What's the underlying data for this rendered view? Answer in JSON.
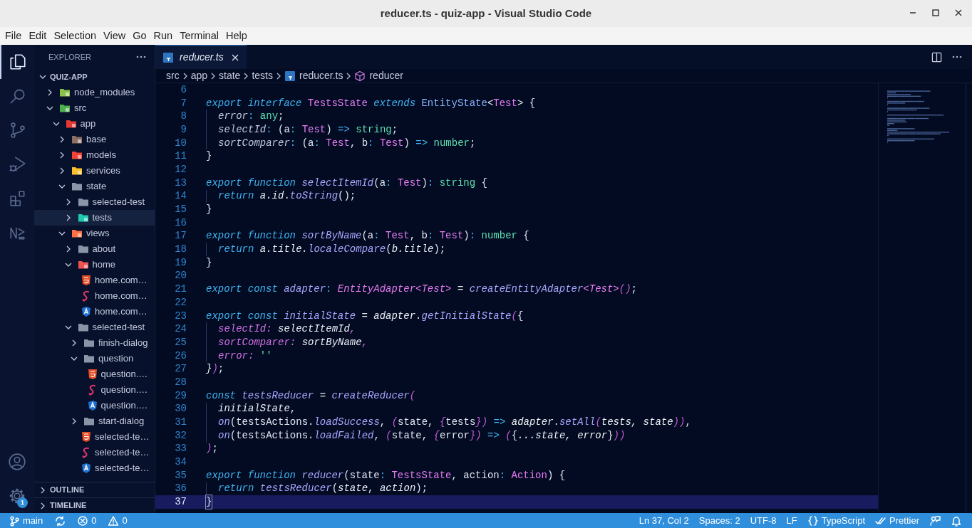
{
  "window": {
    "title": "reducer.ts - quiz-app - Visual Studio Code"
  },
  "menu": [
    "File",
    "Edit",
    "Selection",
    "View",
    "Go",
    "Run",
    "Terminal",
    "Help"
  ],
  "activity_bar": [
    {
      "kind": "files",
      "selected": true
    },
    {
      "kind": "search",
      "selected": false
    },
    {
      "kind": "source-control",
      "selected": false
    },
    {
      "kind": "run-debug",
      "selected": false
    },
    {
      "kind": "extensions",
      "selected": false
    },
    {
      "kind": "logo",
      "selected": false
    }
  ],
  "activity_bar_bottom": [
    {
      "kind": "account"
    },
    {
      "kind": "settings",
      "badge": "1"
    }
  ],
  "sidebar": {
    "title": "EXPLORER",
    "root": {
      "label": "QUIZ-APP",
      "expanded": true,
      "children": [
        {
          "label": "node_modules",
          "kind": "node",
          "expanded": false,
          "selected": false
        },
        {
          "label": "src",
          "kind": "src",
          "expanded": true,
          "selected": false,
          "children": [
            {
              "label": "app",
              "kind": "app",
              "expanded": true,
              "selected": false,
              "children": [
                {
                  "label": "base",
                  "kind": "base",
                  "expanded": false,
                  "selected": false
                },
                {
                  "label": "models",
                  "kind": "models",
                  "expanded": false,
                  "selected": false
                },
                {
                  "label": "services",
                  "kind": "services",
                  "expanded": false,
                  "selected": false
                },
                {
                  "label": "state",
                  "kind": "folder",
                  "expanded": true,
                  "selected": false,
                  "children": [
                    {
                      "label": "selected-test",
                      "kind": "folder",
                      "expanded": false,
                      "selected": false
                    },
                    {
                      "label": "tests",
                      "kind": "tests",
                      "expanded": false,
                      "selected": true
                    }
                  ]
                },
                {
                  "label": "views",
                  "kind": "views",
                  "expanded": true,
                  "selected": false,
                  "children": [
                    {
                      "label": "about",
                      "kind": "folder",
                      "expanded": false,
                      "selected": false
                    },
                    {
                      "label": "home",
                      "kind": "home",
                      "expanded": true,
                      "selected": false,
                      "children": [
                        {
                          "label": "home.com…",
                          "kind": "html",
                          "selected": false
                        },
                        {
                          "label": "home.com…",
                          "kind": "scss",
                          "selected": false
                        },
                        {
                          "label": "home.com…",
                          "kind": "angular",
                          "selected": false
                        }
                      ]
                    },
                    {
                      "label": "selected-test",
                      "kind": "folder",
                      "expanded": true,
                      "selected": false,
                      "children": [
                        {
                          "label": "finish-dialog",
                          "kind": "folder",
                          "expanded": false,
                          "selected": false
                        },
                        {
                          "label": "question",
                          "kind": "folder",
                          "expanded": true,
                          "selected": false,
                          "children": [
                            {
                              "label": "question.…",
                              "kind": "html",
                              "selected": false
                            },
                            {
                              "label": "question.…",
                              "kind": "scss",
                              "selected": false
                            },
                            {
                              "label": "question.…",
                              "kind": "angular",
                              "selected": false
                            }
                          ]
                        },
                        {
                          "label": "start-dialog",
                          "kind": "folder",
                          "expanded": false,
                          "selected": false
                        },
                        {
                          "label": "selected-te…",
                          "kind": "html",
                          "selected": false
                        },
                        {
                          "label": "selected-te…",
                          "kind": "scss",
                          "selected": false
                        },
                        {
                          "label": "selected-te…",
                          "kind": "angular",
                          "selected": false
                        }
                      ]
                    }
                  ]
                }
              ]
            }
          ]
        }
      ]
    },
    "sections": [
      {
        "label": "OUTLINE",
        "expanded": false
      },
      {
        "label": "TIMELINE",
        "expanded": false
      }
    ]
  },
  "tabs": [
    {
      "label": "reducer.ts",
      "kind": "ts",
      "selected": true
    }
  ],
  "breadcrumbs": [
    {
      "label": "src",
      "kind": "folder"
    },
    {
      "label": "app",
      "kind": "folder"
    },
    {
      "label": "state",
      "kind": "folder"
    },
    {
      "label": "tests",
      "kind": "folder"
    },
    {
      "label": "reducer.ts",
      "kind": "ts"
    },
    {
      "label": "reducer",
      "kind": "symbol"
    }
  ],
  "editor": {
    "lines": [
      {
        "number": "6",
        "current": false
      },
      {
        "number": "7",
        "current": false,
        "tokens": [
          {
            "text": "export ",
            "kind": "kw"
          },
          {
            "text": "interface ",
            "kind": "kw"
          },
          {
            "text": "TestsState ",
            "kind": "type"
          },
          {
            "text": "extends ",
            "kind": "kw"
          },
          {
            "text": "EntityState",
            "kind": "etype"
          },
          {
            "text": "<",
            "kind": "plain"
          },
          {
            "text": "Test",
            "kind": "type"
          },
          {
            "text": "> {",
            "kind": "plain"
          }
        ]
      },
      {
        "number": "8",
        "current": false,
        "indented": true,
        "tokens": [
          {
            "text": "error",
            "kind": "prop"
          },
          {
            "text": ": ",
            "kind": "op"
          },
          {
            "text": "any",
            "kind": "prim"
          },
          {
            "text": ";",
            "kind": "plain"
          }
        ]
      },
      {
        "number": "9",
        "current": false,
        "indented": true,
        "tokens": [
          {
            "text": "selectId",
            "kind": "prop"
          },
          {
            "text": ": ",
            "kind": "op"
          },
          {
            "text": "(a",
            "kind": "plain"
          },
          {
            "text": ": ",
            "kind": "op"
          },
          {
            "text": "Test",
            "kind": "type"
          },
          {
            "text": ") ",
            "kind": "plain"
          },
          {
            "text": "=> ",
            "kind": "op"
          },
          {
            "text": "string",
            "kind": "prim"
          },
          {
            "text": ";",
            "kind": "plain"
          }
        ]
      },
      {
        "number": "10",
        "current": false,
        "indented": true,
        "tokens": [
          {
            "text": "sortComparer",
            "kind": "prop"
          },
          {
            "text": ": ",
            "kind": "op"
          },
          {
            "text": "(a",
            "kind": "plain"
          },
          {
            "text": ": ",
            "kind": "op"
          },
          {
            "text": "Test",
            "kind": "type"
          },
          {
            "text": ", b",
            "kind": "plain"
          },
          {
            "text": ": ",
            "kind": "op"
          },
          {
            "text": "Test",
            "kind": "type"
          },
          {
            "text": ") ",
            "kind": "plain"
          },
          {
            "text": "=> ",
            "kind": "op"
          },
          {
            "text": "number",
            "kind": "prim"
          },
          {
            "text": ";",
            "kind": "plain"
          }
        ]
      },
      {
        "number": "11",
        "current": false,
        "tokens": [
          {
            "text": "}",
            "kind": "plain"
          }
        ]
      },
      {
        "number": "12",
        "current": false
      },
      {
        "number": "13",
        "current": false,
        "tokens": [
          {
            "text": "export function ",
            "kind": "kw"
          },
          {
            "text": "selectItemId",
            "kind": "fn"
          },
          {
            "text": "(a",
            "kind": "plain"
          },
          {
            "text": ": ",
            "kind": "op"
          },
          {
            "text": "Test",
            "kind": "type"
          },
          {
            "text": ")",
            "kind": "plain"
          },
          {
            "text": ": ",
            "kind": "op"
          },
          {
            "text": "string",
            "kind": "prim"
          },
          {
            "text": " {",
            "kind": "plain"
          }
        ]
      },
      {
        "number": "14",
        "current": false,
        "indented": true,
        "tokens": [
          {
            "text": "return ",
            "kind": "kw"
          },
          {
            "text": "a.id",
            "kind": "var"
          },
          {
            "text": ".",
            "kind": "plain"
          },
          {
            "text": "toString",
            "kind": "fn"
          },
          {
            "text": "();",
            "kind": "plain"
          }
        ]
      },
      {
        "number": "15",
        "current": false,
        "tokens": [
          {
            "text": "}",
            "kind": "plain"
          }
        ]
      },
      {
        "number": "16",
        "current": false
      },
      {
        "number": "17",
        "current": false,
        "tokens": [
          {
            "text": "export function ",
            "kind": "kw"
          },
          {
            "text": "sortByName",
            "kind": "fn"
          },
          {
            "text": "(a",
            "kind": "plain"
          },
          {
            "text": ": ",
            "kind": "op"
          },
          {
            "text": "Test",
            "kind": "type"
          },
          {
            "text": ", b",
            "kind": "plain"
          },
          {
            "text": ": ",
            "kind": "op"
          },
          {
            "text": "Test",
            "kind": "type"
          },
          {
            "text": ")",
            "kind": "plain"
          },
          {
            "text": ": ",
            "kind": "op"
          },
          {
            "text": "number",
            "kind": "prim"
          },
          {
            "text": " {",
            "kind": "plain"
          }
        ]
      },
      {
        "number": "18",
        "current": false,
        "indented": true,
        "tokens": [
          {
            "text": "return ",
            "kind": "kw"
          },
          {
            "text": "a.title.",
            "kind": "var"
          },
          {
            "text": "localeCompare",
            "kind": "fn"
          },
          {
            "text": "(",
            "kind": "plain"
          },
          {
            "text": "b.title",
            "kind": "var"
          },
          {
            "text": ");",
            "kind": "plain"
          }
        ]
      },
      {
        "number": "19",
        "current": false,
        "tokens": [
          {
            "text": "}",
            "kind": "plain"
          }
        ]
      },
      {
        "number": "20",
        "current": false
      },
      {
        "number": "21",
        "current": false,
        "tokens": [
          {
            "text": "export const ",
            "kind": "kw"
          },
          {
            "text": "adapter",
            "kind": "fn"
          },
          {
            "text": ": ",
            "kind": "op"
          },
          {
            "text": "EntityAdapter<Test>",
            "kind": "gtype"
          },
          {
            "text": " = ",
            "kind": "plain"
          },
          {
            "text": "createEntityAdapter",
            "kind": "fn"
          },
          {
            "text": "<Test>",
            "kind": "gtype"
          },
          {
            "text": "()",
            "kind": "paren"
          },
          {
            "text": ";",
            "kind": "plain"
          }
        ]
      },
      {
        "number": "22",
        "current": false
      },
      {
        "number": "23",
        "current": false,
        "tokens": [
          {
            "text": "export const ",
            "kind": "kw"
          },
          {
            "text": "initialState",
            "kind": "fn"
          },
          {
            "text": " = ",
            "kind": "plain"
          },
          {
            "text": "adapter",
            "kind": "var"
          },
          {
            "text": ".",
            "kind": "plain"
          },
          {
            "text": "getInitialState",
            "kind": "fn"
          },
          {
            "text": "(",
            "kind": "paren"
          },
          {
            "text": "{",
            "kind": "plain"
          }
        ]
      },
      {
        "number": "24",
        "current": false,
        "indented": true,
        "tokens": [
          {
            "text": "selectId: ",
            "kind": "pprop"
          },
          {
            "text": "selectItemId",
            "kind": "var"
          },
          {
            "text": ",",
            "kind": "pprop"
          }
        ]
      },
      {
        "number": "25",
        "current": false,
        "indented": true,
        "tokens": [
          {
            "text": "sortComparer: ",
            "kind": "pprop"
          },
          {
            "text": "sortByName",
            "kind": "var"
          },
          {
            "text": ",",
            "kind": "pprop"
          }
        ]
      },
      {
        "number": "26",
        "current": false,
        "indented": true,
        "tokens": [
          {
            "text": "error: ",
            "kind": "pprop"
          },
          {
            "text": "''",
            "kind": "str"
          }
        ]
      },
      {
        "number": "27",
        "current": false,
        "tokens": [
          {
            "text": "}",
            "kind": "var"
          },
          {
            "text": ")",
            "kind": "paren"
          },
          {
            "text": ";",
            "kind": "plain"
          }
        ]
      },
      {
        "number": "28",
        "current": false
      },
      {
        "number": "29",
        "current": false,
        "tokens": [
          {
            "text": "const ",
            "kind": "kw"
          },
          {
            "text": "testsReducer",
            "kind": "fn"
          },
          {
            "text": " = ",
            "kind": "plain"
          },
          {
            "text": "createReducer",
            "kind": "fn"
          },
          {
            "text": "(",
            "kind": "paren"
          }
        ]
      },
      {
        "number": "30",
        "current": false,
        "indented": true,
        "tokens": [
          {
            "text": "initialState",
            "kind": "var"
          },
          {
            "text": ",",
            "kind": "plain"
          }
        ]
      },
      {
        "number": "31",
        "current": false,
        "indented": true,
        "tokens": [
          {
            "text": "on",
            "kind": "fn"
          },
          {
            "text": "(testsActions.",
            "kind": "plain"
          },
          {
            "text": "loadSuccess",
            "kind": "fn"
          },
          {
            "text": ", ",
            "kind": "plain"
          },
          {
            "text": "(",
            "kind": "paren"
          },
          {
            "text": "state, ",
            "kind": "plain"
          },
          {
            "text": "{",
            "kind": "paren"
          },
          {
            "text": "tests",
            "kind": "plain"
          },
          {
            "text": "})",
            "kind": "paren"
          },
          {
            "text": " => ",
            "kind": "op"
          },
          {
            "text": "adapter",
            "kind": "var"
          },
          {
            "text": ".",
            "kind": "plain"
          },
          {
            "text": "setAll",
            "kind": "fn"
          },
          {
            "text": "(",
            "kind": "paren"
          },
          {
            "text": "tests, state",
            "kind": "var"
          },
          {
            "text": "))",
            "kind": "paren"
          },
          {
            "text": ",",
            "kind": "plain"
          }
        ]
      },
      {
        "number": "32",
        "current": false,
        "indented": true,
        "tokens": [
          {
            "text": "on",
            "kind": "fn"
          },
          {
            "text": "(testsActions.",
            "kind": "plain"
          },
          {
            "text": "loadFailed",
            "kind": "fn"
          },
          {
            "text": ", ",
            "kind": "plain"
          },
          {
            "text": "(",
            "kind": "paren"
          },
          {
            "text": "state, ",
            "kind": "plain"
          },
          {
            "text": "{",
            "kind": "paren"
          },
          {
            "text": "error",
            "kind": "plain"
          },
          {
            "text": "})",
            "kind": "paren"
          },
          {
            "text": " => ",
            "kind": "op"
          },
          {
            "text": "(",
            "kind": "paren"
          },
          {
            "text": "{",
            "kind": "plain"
          },
          {
            "text": "...state, error",
            "kind": "var"
          },
          {
            "text": "}",
            "kind": "plain"
          },
          {
            "text": "))",
            "kind": "paren"
          }
        ]
      },
      {
        "number": "33",
        "current": false,
        "tokens": [
          {
            "text": ")",
            "kind": "paren"
          },
          {
            "text": ";",
            "kind": "plain"
          }
        ]
      },
      {
        "number": "34",
        "current": false
      },
      {
        "number": "35",
        "current": false,
        "tokens": [
          {
            "text": "export function ",
            "kind": "kw"
          },
          {
            "text": "reducer",
            "kind": "fn"
          },
          {
            "text": "(state",
            "kind": "plain"
          },
          {
            "text": ": ",
            "kind": "op"
          },
          {
            "text": "TestsState",
            "kind": "type"
          },
          {
            "text": ", action",
            "kind": "plain"
          },
          {
            "text": ": ",
            "kind": "op"
          },
          {
            "text": "Action",
            "kind": "type"
          },
          {
            "text": ") {",
            "kind": "plain"
          }
        ]
      },
      {
        "number": "36",
        "current": false,
        "indented": true,
        "tokens": [
          {
            "text": "return ",
            "kind": "kw"
          },
          {
            "text": "testsReducer",
            "kind": "fn"
          },
          {
            "text": "(",
            "kind": "plain"
          },
          {
            "text": "state",
            "kind": "var"
          },
          {
            "text": ", ",
            "kind": "plain"
          },
          {
            "text": "action",
            "kind": "var"
          },
          {
            "text": ");",
            "kind": "plain"
          }
        ]
      },
      {
        "number": "37",
        "current": true,
        "tokens": [
          {
            "text": "}",
            "kind": "plain"
          }
        ]
      }
    ]
  },
  "status_bar": {
    "left": [
      {
        "kind": "branch",
        "text": "main"
      },
      {
        "kind": "sync"
      },
      {
        "kind": "errors",
        "text": "0"
      },
      {
        "kind": "warnings",
        "text": "0"
      }
    ],
    "right": [
      {
        "kind": "text",
        "text": "Ln 37, Col 2"
      },
      {
        "kind": "text",
        "text": "Spaces: 2"
      },
      {
        "kind": "text",
        "text": "UTF-8"
      },
      {
        "kind": "text",
        "text": "LF"
      },
      {
        "kind": "language",
        "text": "TypeScript"
      },
      {
        "kind": "formatter",
        "text": "Prettier"
      },
      {
        "kind": "feedback"
      },
      {
        "kind": "notifications"
      }
    ]
  }
}
